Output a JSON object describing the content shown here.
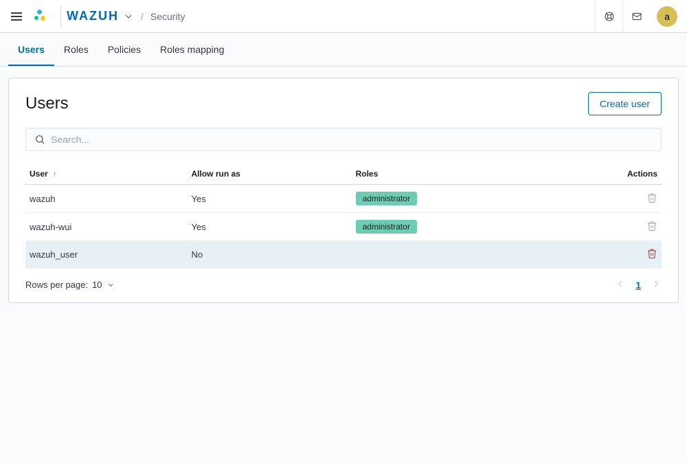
{
  "header": {
    "brand": "WAZUH",
    "breadcrumb": "Security",
    "avatar_letter": "a"
  },
  "tabs": [
    {
      "id": "users",
      "label": "Users",
      "active": true
    },
    {
      "id": "roles",
      "label": "Roles",
      "active": false
    },
    {
      "id": "policies",
      "label": "Policies",
      "active": false
    },
    {
      "id": "roles-mapping",
      "label": "Roles mapping",
      "active": false
    }
  ],
  "panel": {
    "title": "Users",
    "create_button": "Create user",
    "search_placeholder": "Search..."
  },
  "table": {
    "columns": {
      "user": "User",
      "allow_run_as": "Allow run as",
      "roles": "Roles",
      "actions": "Actions"
    },
    "rows": [
      {
        "user": "wazuh",
        "allow_run_as": "Yes",
        "roles": [
          "administrator"
        ],
        "hover": false
      },
      {
        "user": "wazuh-wui",
        "allow_run_as": "Yes",
        "roles": [
          "administrator"
        ],
        "hover": false
      },
      {
        "user": "wazuh_user",
        "allow_run_as": "No",
        "roles": [],
        "hover": true
      }
    ]
  },
  "pagination": {
    "rows_label": "Rows per page:",
    "rows_value": "10",
    "current_page": "1"
  }
}
